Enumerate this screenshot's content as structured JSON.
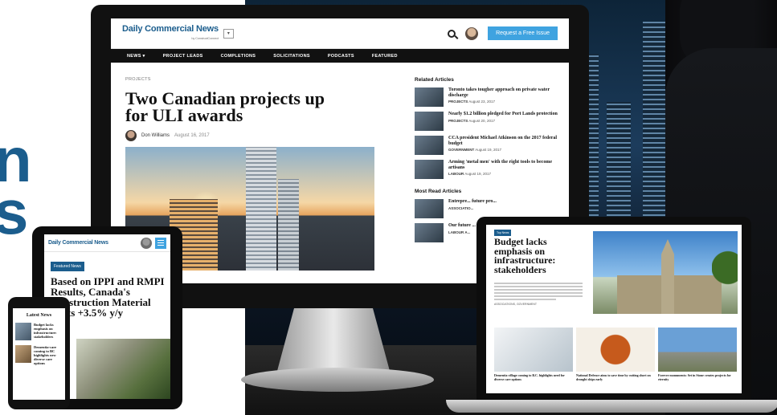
{
  "colors": {
    "brand": "#1b5d8d",
    "accent": "#3fa3e0",
    "nav": "#111111"
  },
  "hero_fragment": {
    "line1": "n",
    "line2": "s"
  },
  "desktop": {
    "logo": "Daily Commercial News",
    "logo_sub": "by ConstructConnect",
    "dropdown_icon": "chevron-down-icon",
    "cta": "Request a Free Issue",
    "nav": [
      "NEWS ▾",
      "PROJECT LEADS",
      "COMPLETIONS",
      "SOLICITATIONS",
      "PODCASTS",
      "FEATURED"
    ],
    "section": "PROJECTS",
    "title": "Two Canadian projects up for ULI awards",
    "author": "Don Williams",
    "date": "August 16, 2017",
    "related_heading": "Related Articles",
    "related": [
      {
        "title": "Toronto takes tougher approach on private water discharge",
        "category": "PROJECTS",
        "date": "August 23, 2017"
      },
      {
        "title": "Nearly $1.2 billion pledged for Port Lands protection",
        "category": "PROJECTS",
        "date": "August 20, 2017"
      },
      {
        "title": "CCA president Michael Atkinson on the 2017 federal budget",
        "category": "GOVERNMENT",
        "date": "August 19, 2017"
      },
      {
        "title": "Arming 'metal men' with the right tools to become artisans",
        "category": "LABOUR",
        "date": "August 19, 2017"
      }
    ],
    "most_read_heading": "Most Read Articles",
    "most_read": [
      {
        "title": "Entrepre... future pro...",
        "category": "ASSOCIATIO..."
      },
      {
        "title": "Our future ... more autom...",
        "category": "LABOUR A..."
      }
    ]
  },
  "tablet": {
    "logo": "Daily Commercial News",
    "badge": "Featured News",
    "title": "Based on IPPI and RMPI Results, Canada's Construction Material Costs +3.5% y/y"
  },
  "phone": {
    "heading": "Latest News",
    "items": [
      "Budget lacks emphasis on infrastructure: stakeholders",
      "Dementia-care coming to BC highlights new diverse care options"
    ]
  },
  "laptop": {
    "badge": "Top News",
    "title": "Budget lacks emphasis on infrastructure: stakeholders",
    "meta": "ASSOCIATIONS, GOVERNMENT",
    "cards": [
      "Dementia village coming to B.C. highlights need for diverse care options",
      "National Defence aims to save time by cutting short on drought ships early",
      "Forever monuments: Set in Stone creates projects for eternity"
    ]
  }
}
